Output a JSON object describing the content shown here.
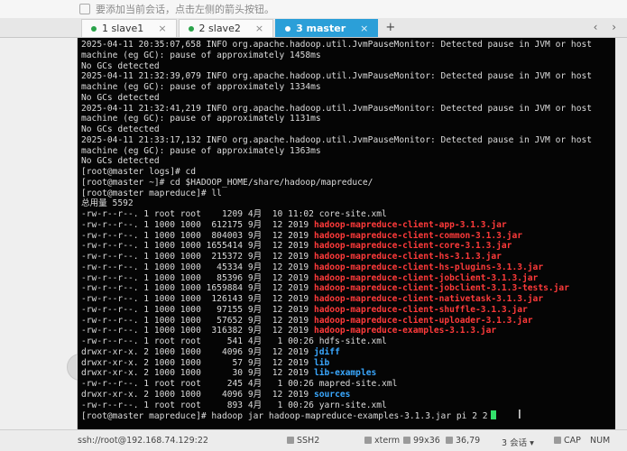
{
  "hint": {
    "text": "要添加当前会话，点击左侧的箭头按钮。"
  },
  "tabs": [
    {
      "label": "1 slave1",
      "active": false
    },
    {
      "label": "2 slave2",
      "active": false
    },
    {
      "label": "3 master",
      "active": true
    }
  ],
  "tab_close": "×",
  "tab_add": "+",
  "tab_nav": "‹ ›",
  "terminal": {
    "lines": [
      [
        {
          "t": "2025-04-11 20:35:07,658 INFO org.apache.hadoop.util.JvmPauseMonitor: Detected pause in JVM or host"
        }
      ],
      [
        {
          "t": "machine (eg GC): pause of approximately 1458ms"
        }
      ],
      [
        {
          "t": "No GCs detected"
        }
      ],
      [
        {
          "t": "2025-04-11 21:32:39,079 INFO org.apache.hadoop.util.JvmPauseMonitor: Detected pause in JVM or host"
        }
      ],
      [
        {
          "t": "machine (eg GC): pause of approximately 1334ms"
        }
      ],
      [
        {
          "t": "No GCs detected"
        }
      ],
      [
        {
          "t": "2025-04-11 21:32:41,219 INFO org.apache.hadoop.util.JvmPauseMonitor: Detected pause in JVM or host"
        }
      ],
      [
        {
          "t": "machine (eg GC): pause of approximately 1131ms"
        }
      ],
      [
        {
          "t": "No GCs detected"
        }
      ],
      [
        {
          "t": "2025-04-11 21:33:17,132 INFO org.apache.hadoop.util.JvmPauseMonitor: Detected pause in JVM or host"
        }
      ],
      [
        {
          "t": "machine (eg GC): pause of approximately 1363ms"
        }
      ],
      [
        {
          "t": "No GCs detected"
        }
      ],
      [
        {
          "t": "[root@master logs]# cd"
        }
      ],
      [
        {
          "t": "[root@master ~]# cd $HADOOP_HOME/share/hadoop/mapreduce/"
        }
      ],
      [
        {
          "t": "[root@master mapreduce]# ll"
        }
      ],
      [
        {
          "t": "总用量 5592"
        }
      ],
      [
        {
          "t": "-rw-r--r--. 1 root root    1209 4月  10 11:02 core-site.xml"
        }
      ],
      [
        {
          "t": "-rw-r--r--. 1 1000 1000  612175 9月  12 2019 "
        },
        {
          "t": "hadoop-mapreduce-client-app-3.1.3.jar",
          "c": "red"
        }
      ],
      [
        {
          "t": "-rw-r--r--. 1 1000 1000  804003 9月  12 2019 "
        },
        {
          "t": "hadoop-mapreduce-client-common-3.1.3.jar",
          "c": "red"
        }
      ],
      [
        {
          "t": "-rw-r--r--. 1 1000 1000 1655414 9月  12 2019 "
        },
        {
          "t": "hadoop-mapreduce-client-core-3.1.3.jar",
          "c": "red"
        }
      ],
      [
        {
          "t": "-rw-r--r--. 1 1000 1000  215372 9月  12 2019 "
        },
        {
          "t": "hadoop-mapreduce-client-hs-3.1.3.jar",
          "c": "red"
        }
      ],
      [
        {
          "t": "-rw-r--r--. 1 1000 1000   45334 9月  12 2019 "
        },
        {
          "t": "hadoop-mapreduce-client-hs-plugins-3.1.3.jar",
          "c": "red"
        }
      ],
      [
        {
          "t": "-rw-r--r--. 1 1000 1000   85396 9月  12 2019 "
        },
        {
          "t": "hadoop-mapreduce-client-jobclient-3.1.3.jar",
          "c": "red"
        }
      ],
      [
        {
          "t": "-rw-r--r--. 1 1000 1000 1659884 9月  12 2019 "
        },
        {
          "t": "hadoop-mapreduce-client-jobclient-3.1.3-tests.jar",
          "c": "red"
        }
      ],
      [
        {
          "t": "-rw-r--r--. 1 1000 1000  126143 9月  12 2019 "
        },
        {
          "t": "hadoop-mapreduce-client-nativetask-3.1.3.jar",
          "c": "red"
        }
      ],
      [
        {
          "t": "-rw-r--r--. 1 1000 1000   97155 9月  12 2019 "
        },
        {
          "t": "hadoop-mapreduce-client-shuffle-3.1.3.jar",
          "c": "red"
        }
      ],
      [
        {
          "t": "-rw-r--r--. 1 1000 1000   57652 9月  12 2019 "
        },
        {
          "t": "hadoop-mapreduce-client-uploader-3.1.3.jar",
          "c": "red"
        }
      ],
      [
        {
          "t": "-rw-r--r--. 1 1000 1000  316382 9月  12 2019 "
        },
        {
          "t": "hadoop-mapreduce-examples-3.1.3.jar",
          "c": "red"
        }
      ],
      [
        {
          "t": "-rw-r--r--. 1 root root     541 4月   1 00:26 hdfs-site.xml"
        }
      ],
      [
        {
          "t": "drwxr-xr-x. 2 1000 1000    4096 9月  12 2019 "
        },
        {
          "t": "jdiff",
          "c": "blue"
        }
      ],
      [
        {
          "t": "drwxr-xr-x. 2 1000 1000      57 9月  12 2019 "
        },
        {
          "t": "lib",
          "c": "blue"
        }
      ],
      [
        {
          "t": "drwxr-xr-x. 2 1000 1000      30 9月  12 2019 "
        },
        {
          "t": "lib-examples",
          "c": "blue"
        }
      ],
      [
        {
          "t": "-rw-r--r--. 1 root root     245 4月   1 00:26 mapred-site.xml"
        }
      ],
      [
        {
          "t": "drwxr-xr-x. 2 1000 1000    4096 9月  12 2019 "
        },
        {
          "t": "sources",
          "c": "blue"
        }
      ],
      [
        {
          "t": "-rw-r--r--. 1 root root     893 4月   1 00:26 yarn-site.xml"
        }
      ],
      [
        {
          "t": "[root@master mapreduce]# hadoop jar hadoop-mapreduce-examples-3.1.3.jar pi 2 2"
        }
      ]
    ]
  },
  "status": {
    "connection": "ssh://root@192.168.74.129:22",
    "protocol": "SSH2",
    "term": "xterm",
    "size": "99x36",
    "cursor_pos": "36,79",
    "sessions": "3 会话",
    "caps": "CAP",
    "num": "NUM"
  },
  "colors": {
    "accent": "#2b9fd8",
    "red": "#ff3a3a",
    "blue": "#3aa8ff",
    "cursor": "#33e06b"
  }
}
